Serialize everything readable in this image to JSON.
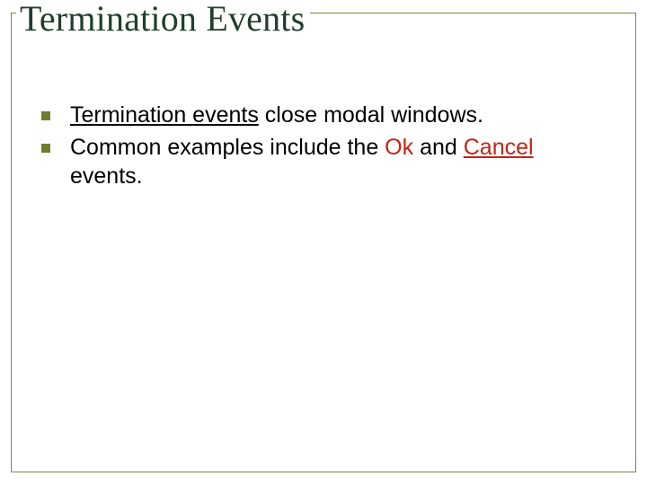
{
  "slide": {
    "title": "Termination Events",
    "bullets": [
      {
        "pre": "",
        "emph": "Termination events",
        "post": " close modal windows."
      },
      {
        "pre": "Common examples include the ",
        "ok": "Ok",
        "mid": " and ",
        "cancel": "Cancel",
        "post": " events."
      }
    ]
  }
}
